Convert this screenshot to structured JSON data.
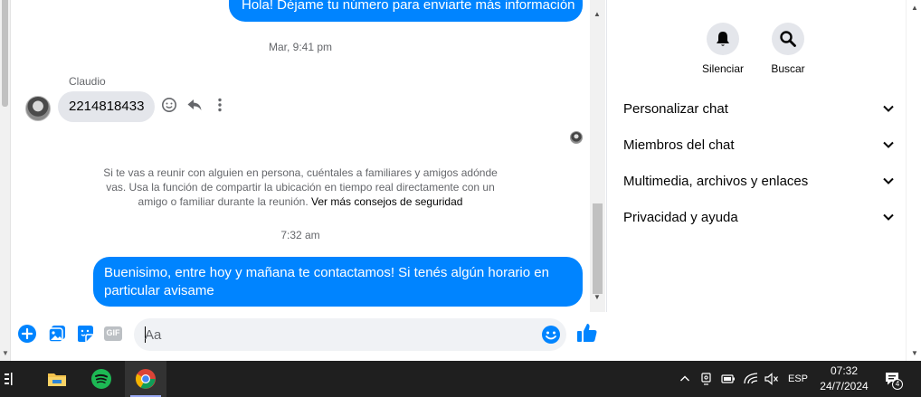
{
  "conversation": {
    "outgoing_top": "Hola! Déjame tu número para enviarte más información",
    "timestamp_1": "Mar, 9:41 pm",
    "sender_name": "Claudio",
    "incoming_message": "2214818433",
    "safety_notice": "Si te vas a reunir con alguien en persona, cuéntales a familiares y amigos adónde vas. Usa la función de compartir la ubicación en tiempo real directamente con un amigo o familiar durante la reunión.",
    "safety_link": "Ver más consejos de seguridad",
    "timestamp_2": "7:32 am",
    "outgoing_last": "Buenisimo, entre hoy y mañana te contactamos! Si tenés algún horario en particular avisame"
  },
  "composer": {
    "placeholder": "Aa",
    "gif_label": "GIF"
  },
  "details": {
    "actions": [
      {
        "label": "Silenciar",
        "icon": "bell-icon"
      },
      {
        "label": "Buscar",
        "icon": "search-icon"
      }
    ],
    "sections": [
      {
        "label": "Personalizar chat"
      },
      {
        "label": "Miembros del chat"
      },
      {
        "label": "Multimedia, archivos y enlaces"
      },
      {
        "label": "Privacidad y ayuda"
      }
    ]
  },
  "taskbar": {
    "language": "ESP",
    "time": "07:32",
    "date": "24/7/2024",
    "notification_count": "4"
  },
  "colors": {
    "messenger_blue": "#0084ff",
    "incoming_bubble": "#e4e6eb",
    "taskbar": "#1f1f1f",
    "spotify_green": "#1db954"
  }
}
